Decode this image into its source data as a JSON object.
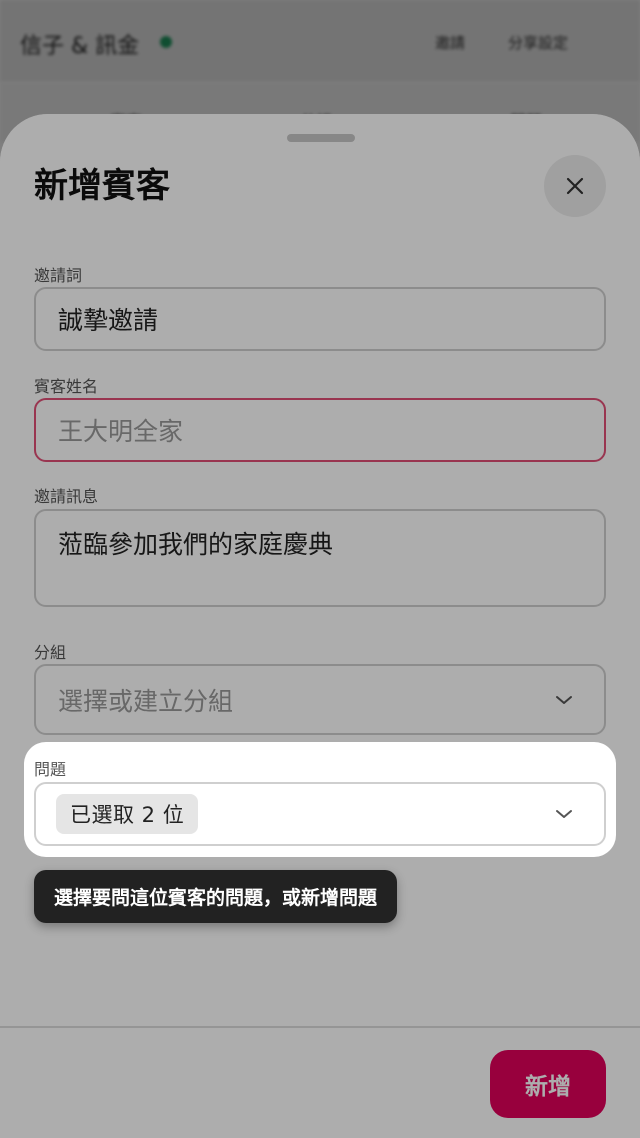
{
  "background": {
    "title": "信子 & 訊金",
    "action1": "邀請",
    "action2": "分享設定",
    "tabs": [
      "賓客",
      "分組",
      "問題"
    ]
  },
  "sheet": {
    "title": "新增賓客",
    "close_icon": "close-icon",
    "fields": {
      "invitation_word": {
        "label": "邀請詞",
        "value": "誠摯邀請"
      },
      "guest_name": {
        "label": "賓客姓名",
        "placeholder": "王大明全家"
      },
      "invitation_message": {
        "label": "邀請訊息",
        "value": "蒞臨參加我們的家庭慶典"
      },
      "group": {
        "label": "分組",
        "placeholder": "選擇或建立分組"
      },
      "questions": {
        "label": "問題",
        "chip": "已選取 2 位"
      }
    },
    "submit_label": "新增"
  },
  "tooltip": "選擇要問這位賓客的問題，或新增問題",
  "colors": {
    "accent": "#e0005a",
    "error_border": "#e24f77",
    "tooltip_bg": "#222222",
    "status_dot": "#1e9c62"
  }
}
